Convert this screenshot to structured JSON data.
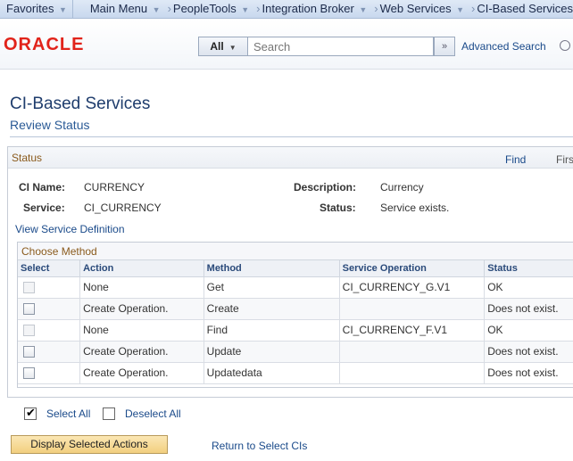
{
  "nav": {
    "favorites": "Favorites",
    "main_menu": "Main Menu",
    "peopletools": "PeopleTools",
    "integration_broker": "Integration Broker",
    "web_services": "Web Services",
    "current": "CI-Based Services"
  },
  "header": {
    "logo": "ORACLE",
    "search_scope": "All",
    "search_placeholder": "Search",
    "search_go": "»",
    "advanced_search": "Advanced Search"
  },
  "page": {
    "title": "CI-Based Services",
    "subtitle": "Review Status"
  },
  "status": {
    "title": "Status",
    "find": "Find",
    "first": "First",
    "ci_name_label": "CI Name:",
    "ci_name": "CURRENCY",
    "service_label": "Service:",
    "service": "CI_CURRENCY",
    "description_label": "Description:",
    "description": "Currency",
    "status_label": "Status:",
    "status_value": "Service exists.",
    "view_service_definition": "View Service Definition"
  },
  "grid": {
    "title": "Choose Method",
    "columns": [
      "Select",
      "Action",
      "Method",
      "Service Operation",
      "Status"
    ],
    "rows": [
      {
        "action": "None",
        "method": "Get",
        "operation": "CI_CURRENCY_G.V1",
        "status": "OK",
        "selectable": false
      },
      {
        "action": "Create Operation.",
        "method": "Create",
        "operation": "",
        "status": "Does not exist.",
        "selectable": true
      },
      {
        "action": "None",
        "method": "Find",
        "operation": "CI_CURRENCY_F.V1",
        "status": "OK",
        "selectable": false
      },
      {
        "action": "Create Operation.",
        "method": "Update",
        "operation": "",
        "status": "Does not exist.",
        "selectable": true
      },
      {
        "action": "Create Operation.",
        "method": "Updatedata",
        "operation": "",
        "status": "Does not exist.",
        "selectable": true
      }
    ]
  },
  "footer": {
    "select_all": "Select All",
    "deselect_all": "Deselect All",
    "display_button": "Display Selected Actions",
    "return_link": "Return to Select CIs"
  }
}
